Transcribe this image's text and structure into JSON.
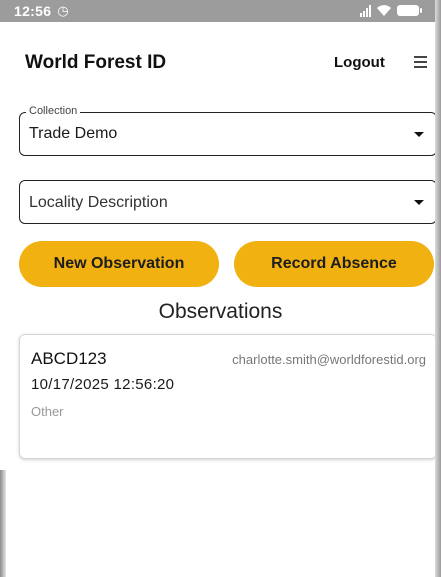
{
  "status_bar": {
    "time": "12:56",
    "alarm_icon": "clock-icon",
    "signal_icon": "signal-icon",
    "wifi_icon": "wifi-icon",
    "battery_icon": "battery-icon"
  },
  "header": {
    "title": "World Forest ID",
    "logout_label": "Logout",
    "menu_icon": "hamburger-menu-icon"
  },
  "collection_field": {
    "legend": "Collection",
    "value": "Trade Demo"
  },
  "locality_field": {
    "placeholder": "Locality Description"
  },
  "actions": {
    "new_observation": "New Observation",
    "record_absence": "Record Absence"
  },
  "observations": {
    "title": "Observations",
    "items": [
      {
        "id": "ABCD123",
        "email": "charlotte.smith@worldforestid.org",
        "datetime": "10/17/2025 12:56:20",
        "type": "Other"
      }
    ]
  },
  "colors": {
    "accent": "#f0b111",
    "status_bar": "#9c9c9c"
  }
}
